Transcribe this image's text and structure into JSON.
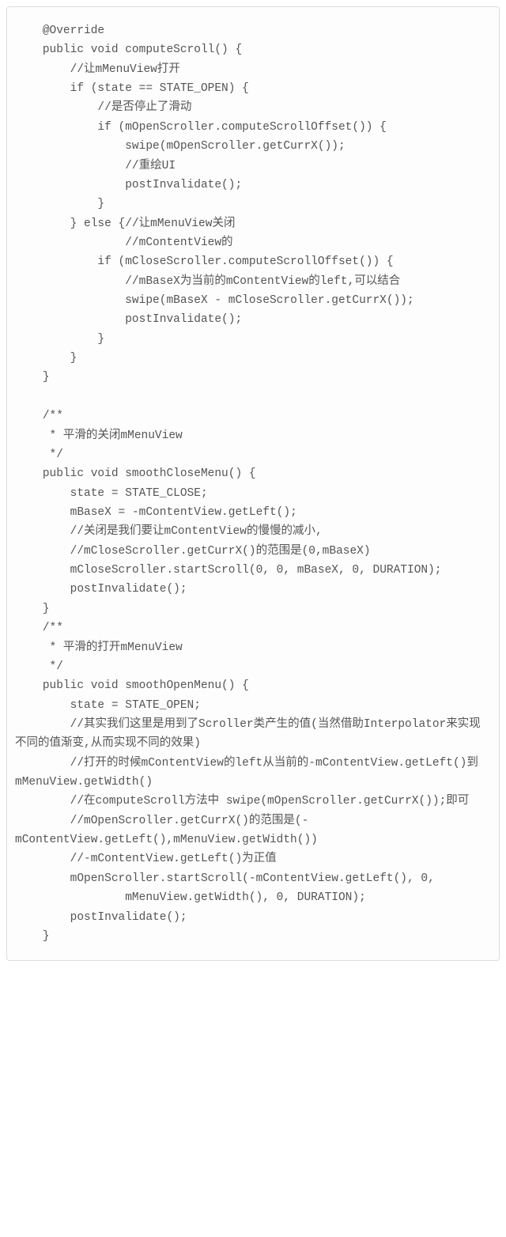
{
  "code": "    @Override\n    public void computeScroll() {\n        //让mMenuView打开\n        if (state == STATE_OPEN) {\n            //是否停止了滑动\n            if (mOpenScroller.computeScrollOffset()) {\n                swipe(mOpenScroller.getCurrX());\n                //重绘UI\n                postInvalidate();\n            }\n        } else {//让mMenuView关闭\n                //mContentView的\n            if (mCloseScroller.computeScrollOffset()) {\n                //mBaseX为当前的mContentView的left,可以结合\n                swipe(mBaseX - mCloseScroller.getCurrX());\n                postInvalidate();\n            }\n        }\n    }\n\n    /**\n     * 平滑的关闭mMenuView\n     */\n    public void smoothCloseMenu() {\n        state = STATE_CLOSE;\n        mBaseX = -mContentView.getLeft();\n        //关闭是我们要让mContentView的慢慢的减小,\n        //mCloseScroller.getCurrX()的范围是(0,mBaseX)\n        mCloseScroller.startScroll(0, 0, mBaseX, 0, DURATION);\n        postInvalidate();\n    }\n    /**\n     * 平滑的打开mMenuView\n     */\n    public void smoothOpenMenu() {\n        state = STATE_OPEN;\n        //其实我们这里是用到了Scroller类产生的值(当然借助Interpolator来实现不同的值渐变,从而实现不同的效果)\n        //打开的时候mContentView的left从当前的-mContentView.getLeft()到mMenuView.getWidth()\n        //在computeScroll方法中 swipe(mOpenScroller.getCurrX());即可\n        //mOpenScroller.getCurrX()的范围是(-mContentView.getLeft(),mMenuView.getWidth())\n        //-mContentView.getLeft()为正值\n        mOpenScroller.startScroll(-mContentView.getLeft(), 0,\n                mMenuView.getWidth(), 0, DURATION);\n        postInvalidate();\n    }"
}
